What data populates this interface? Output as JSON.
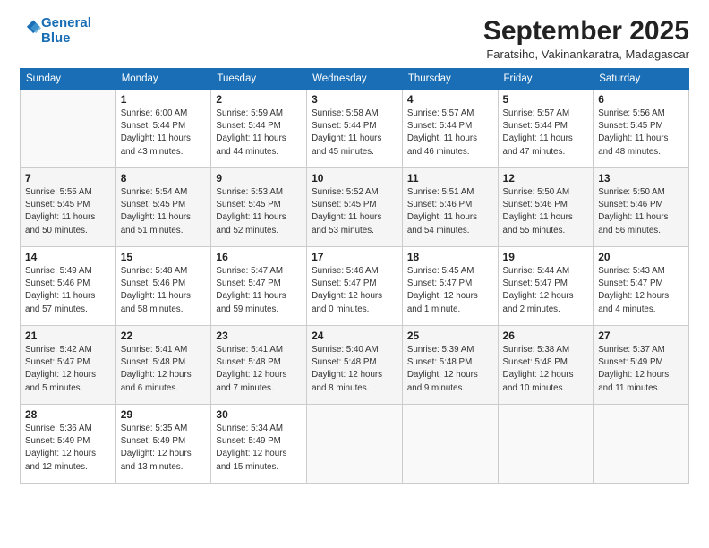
{
  "header": {
    "logo_line1": "General",
    "logo_line2": "Blue",
    "title": "September 2025",
    "location": "Faratsiho, Vakinankaratra, Madagascar"
  },
  "weekdays": [
    "Sunday",
    "Monday",
    "Tuesday",
    "Wednesday",
    "Thursday",
    "Friday",
    "Saturday"
  ],
  "weeks": [
    [
      {
        "day": "",
        "info": ""
      },
      {
        "day": "1",
        "info": "Sunrise: 6:00 AM\nSunset: 5:44 PM\nDaylight: 11 hours\nand 43 minutes."
      },
      {
        "day": "2",
        "info": "Sunrise: 5:59 AM\nSunset: 5:44 PM\nDaylight: 11 hours\nand 44 minutes."
      },
      {
        "day": "3",
        "info": "Sunrise: 5:58 AM\nSunset: 5:44 PM\nDaylight: 11 hours\nand 45 minutes."
      },
      {
        "day": "4",
        "info": "Sunrise: 5:57 AM\nSunset: 5:44 PM\nDaylight: 11 hours\nand 46 minutes."
      },
      {
        "day": "5",
        "info": "Sunrise: 5:57 AM\nSunset: 5:44 PM\nDaylight: 11 hours\nand 47 minutes."
      },
      {
        "day": "6",
        "info": "Sunrise: 5:56 AM\nSunset: 5:45 PM\nDaylight: 11 hours\nand 48 minutes."
      }
    ],
    [
      {
        "day": "7",
        "info": "Sunrise: 5:55 AM\nSunset: 5:45 PM\nDaylight: 11 hours\nand 50 minutes."
      },
      {
        "day": "8",
        "info": "Sunrise: 5:54 AM\nSunset: 5:45 PM\nDaylight: 11 hours\nand 51 minutes."
      },
      {
        "day": "9",
        "info": "Sunrise: 5:53 AM\nSunset: 5:45 PM\nDaylight: 11 hours\nand 52 minutes."
      },
      {
        "day": "10",
        "info": "Sunrise: 5:52 AM\nSunset: 5:45 PM\nDaylight: 11 hours\nand 53 minutes."
      },
      {
        "day": "11",
        "info": "Sunrise: 5:51 AM\nSunset: 5:46 PM\nDaylight: 11 hours\nand 54 minutes."
      },
      {
        "day": "12",
        "info": "Sunrise: 5:50 AM\nSunset: 5:46 PM\nDaylight: 11 hours\nand 55 minutes."
      },
      {
        "day": "13",
        "info": "Sunrise: 5:50 AM\nSunset: 5:46 PM\nDaylight: 11 hours\nand 56 minutes."
      }
    ],
    [
      {
        "day": "14",
        "info": "Sunrise: 5:49 AM\nSunset: 5:46 PM\nDaylight: 11 hours\nand 57 minutes."
      },
      {
        "day": "15",
        "info": "Sunrise: 5:48 AM\nSunset: 5:46 PM\nDaylight: 11 hours\nand 58 minutes."
      },
      {
        "day": "16",
        "info": "Sunrise: 5:47 AM\nSunset: 5:47 PM\nDaylight: 11 hours\nand 59 minutes."
      },
      {
        "day": "17",
        "info": "Sunrise: 5:46 AM\nSunset: 5:47 PM\nDaylight: 12 hours\nand 0 minutes."
      },
      {
        "day": "18",
        "info": "Sunrise: 5:45 AM\nSunset: 5:47 PM\nDaylight: 12 hours\nand 1 minute."
      },
      {
        "day": "19",
        "info": "Sunrise: 5:44 AM\nSunset: 5:47 PM\nDaylight: 12 hours\nand 2 minutes."
      },
      {
        "day": "20",
        "info": "Sunrise: 5:43 AM\nSunset: 5:47 PM\nDaylight: 12 hours\nand 4 minutes."
      }
    ],
    [
      {
        "day": "21",
        "info": "Sunrise: 5:42 AM\nSunset: 5:47 PM\nDaylight: 12 hours\nand 5 minutes."
      },
      {
        "day": "22",
        "info": "Sunrise: 5:41 AM\nSunset: 5:48 PM\nDaylight: 12 hours\nand 6 minutes."
      },
      {
        "day": "23",
        "info": "Sunrise: 5:41 AM\nSunset: 5:48 PM\nDaylight: 12 hours\nand 7 minutes."
      },
      {
        "day": "24",
        "info": "Sunrise: 5:40 AM\nSunset: 5:48 PM\nDaylight: 12 hours\nand 8 minutes."
      },
      {
        "day": "25",
        "info": "Sunrise: 5:39 AM\nSunset: 5:48 PM\nDaylight: 12 hours\nand 9 minutes."
      },
      {
        "day": "26",
        "info": "Sunrise: 5:38 AM\nSunset: 5:48 PM\nDaylight: 12 hours\nand 10 minutes."
      },
      {
        "day": "27",
        "info": "Sunrise: 5:37 AM\nSunset: 5:49 PM\nDaylight: 12 hours\nand 11 minutes."
      }
    ],
    [
      {
        "day": "28",
        "info": "Sunrise: 5:36 AM\nSunset: 5:49 PM\nDaylight: 12 hours\nand 12 minutes."
      },
      {
        "day": "29",
        "info": "Sunrise: 5:35 AM\nSunset: 5:49 PM\nDaylight: 12 hours\nand 13 minutes."
      },
      {
        "day": "30",
        "info": "Sunrise: 5:34 AM\nSunset: 5:49 PM\nDaylight: 12 hours\nand 15 minutes."
      },
      {
        "day": "",
        "info": ""
      },
      {
        "day": "",
        "info": ""
      },
      {
        "day": "",
        "info": ""
      },
      {
        "day": "",
        "info": ""
      }
    ]
  ]
}
